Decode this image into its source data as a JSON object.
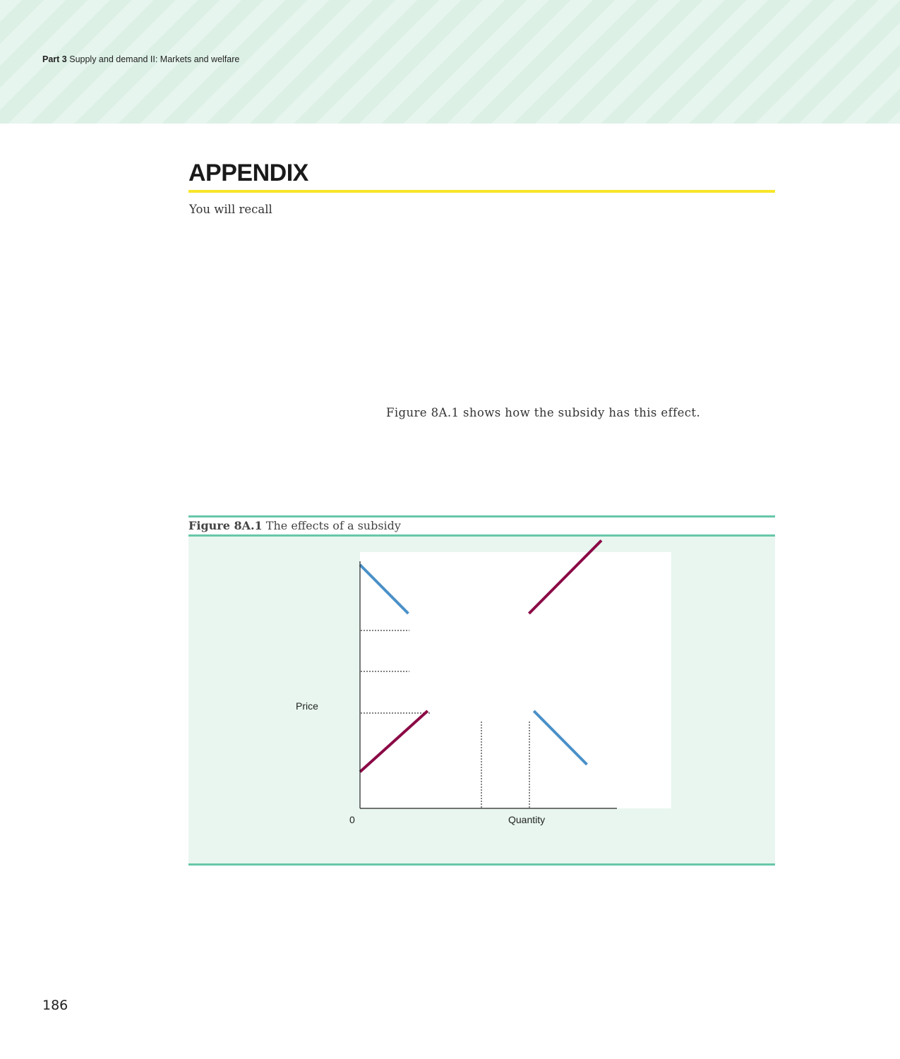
{
  "running_head": {
    "part": "Part 3",
    "title": "Supply and demand II: Markets and welfare"
  },
  "section": {
    "title": "APPENDIX"
  },
  "body": {
    "intro_fragment": "You will recall",
    "figure_reference": "Figure 8A.1 shows how the subsidy has this effect."
  },
  "figure": {
    "number": "Figure 8A.1",
    "caption": "The effects of a subsidy"
  },
  "chart_data": {
    "type": "line",
    "xlabel": "Quantity",
    "ylabel": "Price",
    "origin_label": "0",
    "series": [
      {
        "values": [
          [
            0,
            10
          ],
          [
            2,
            8
          ]
        ],
        "color": "#4a90c8"
      },
      {
        "values": [
          [
            7,
            8
          ],
          [
            10,
            11
          ]
        ],
        "color": "#8b0a46"
      },
      {
        "values": [
          [
            0,
            1.5
          ],
          [
            2.8,
            4
          ]
        ],
        "color": "#8b0a46"
      },
      {
        "values": [
          [
            7.2,
            4
          ],
          [
            9.4,
            1.8
          ]
        ],
        "color": "#4a90c8"
      }
    ],
    "colors": {
      "demand": "#4a90c8",
      "supply": "#8b0a46"
    }
  },
  "page": {
    "number": "186"
  }
}
